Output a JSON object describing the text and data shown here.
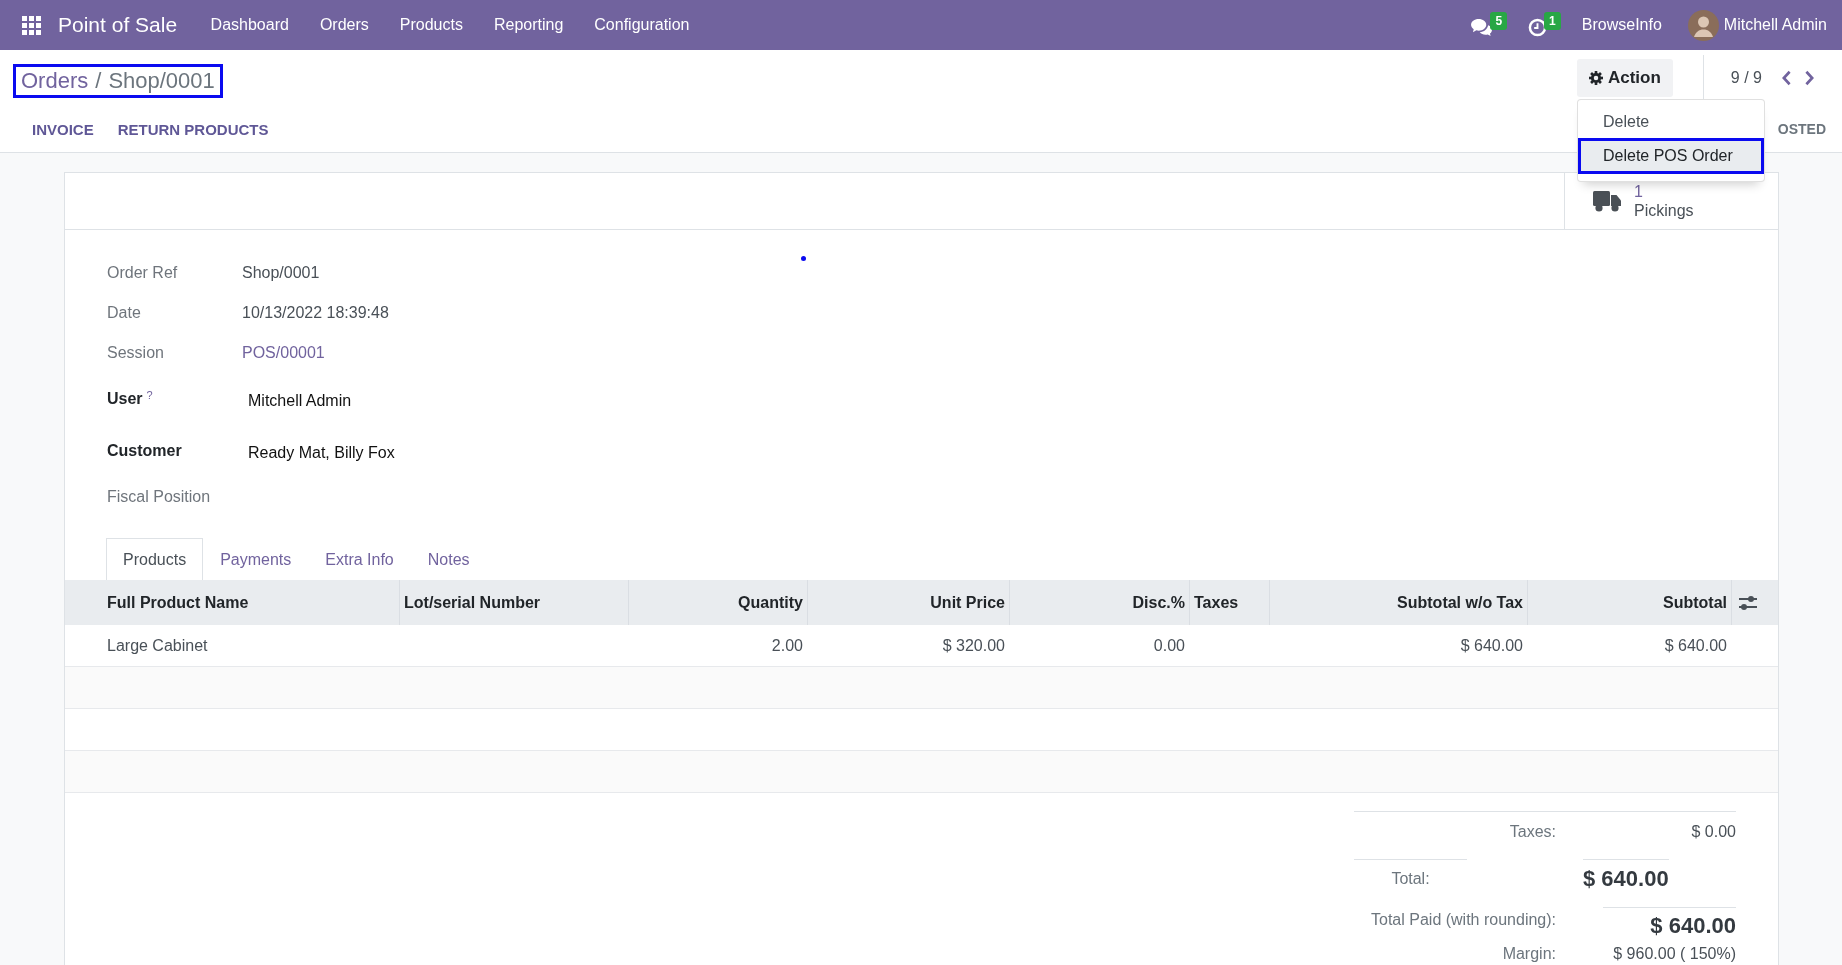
{
  "navbar": {
    "app_name": "Point of Sale",
    "menu": [
      "Dashboard",
      "Orders",
      "Products",
      "Reporting",
      "Configuration"
    ],
    "messages_count": "5",
    "activities_count": "1",
    "company": "BrowseInfo",
    "user": "Mitchell Admin"
  },
  "breadcrumb": {
    "parent": "Orders",
    "separator": "/",
    "current": "Shop/0001",
    "highlighted": true
  },
  "action_menu": {
    "label": "Action",
    "expanded": true,
    "items": [
      {
        "label": "Delete",
        "highlighted": false
      },
      {
        "label": "Delete POS Order",
        "highlighted": true
      }
    ]
  },
  "pager": {
    "value": "9 / 9"
  },
  "header_buttons": [
    "INVOICE",
    "RETURN PRODUCTS"
  ],
  "status_bar": {
    "stage": "OSTED"
  },
  "smart_buttons": [
    {
      "count": "1",
      "label": "Pickings"
    }
  ],
  "fields": [
    {
      "label": "Order Ref",
      "value": "Shop/0001",
      "kind": "readonly"
    },
    {
      "label": "Date",
      "value": "10/13/2022 18:39:48",
      "kind": "readonly"
    },
    {
      "label": "Session",
      "value": "POS/00001",
      "kind": "link"
    },
    {
      "label": "User",
      "help": "?",
      "value": "Mitchell Admin",
      "kind": "required"
    },
    {
      "label": "Customer",
      "value": "Ready Mat, Billy Fox",
      "kind": "required"
    },
    {
      "label": "Fiscal Position",
      "kind": "readonly"
    }
  ],
  "notebook": {
    "tabs": [
      {
        "label": "Products",
        "selected": true
      },
      {
        "label": "Payments",
        "selected": false
      },
      {
        "label": "Extra Info",
        "selected": false
      },
      {
        "label": "Notes",
        "selected": false
      }
    ]
  },
  "table": {
    "columns": [
      {
        "label": "Full Product Name",
        "numeric": false
      },
      {
        "label": "Lot/serial Number",
        "numeric": false
      },
      {
        "label": "Quantity",
        "numeric": true
      },
      {
        "label": "Unit Price",
        "numeric": true
      },
      {
        "label": "Disc.%",
        "numeric": true
      },
      {
        "label": "Taxes",
        "numeric": false
      },
      {
        "label": "Subtotal w/o Tax",
        "numeric": true
      },
      {
        "label": "Subtotal",
        "numeric": true
      }
    ],
    "rows": [
      {
        "cells": [
          "Large Cabinet",
          null,
          "2.00",
          "$ 320.00",
          "0.00",
          null,
          "$ 640.00",
          "$ 640.00"
        ]
      }
    ]
  },
  "totals": [
    {
      "label": "Taxes:",
      "value": "$ 0.00",
      "kind": "plain"
    },
    {
      "label": "Total:",
      "value": "$ 640.00",
      "kind": "total"
    },
    {
      "label": "Total Paid (with rounding):",
      "value": "$ 640.00",
      "kind": "paid"
    },
    {
      "label": "Margin:",
      "value": "$ 960.00 ( 150%)",
      "kind": "plain"
    }
  ]
}
